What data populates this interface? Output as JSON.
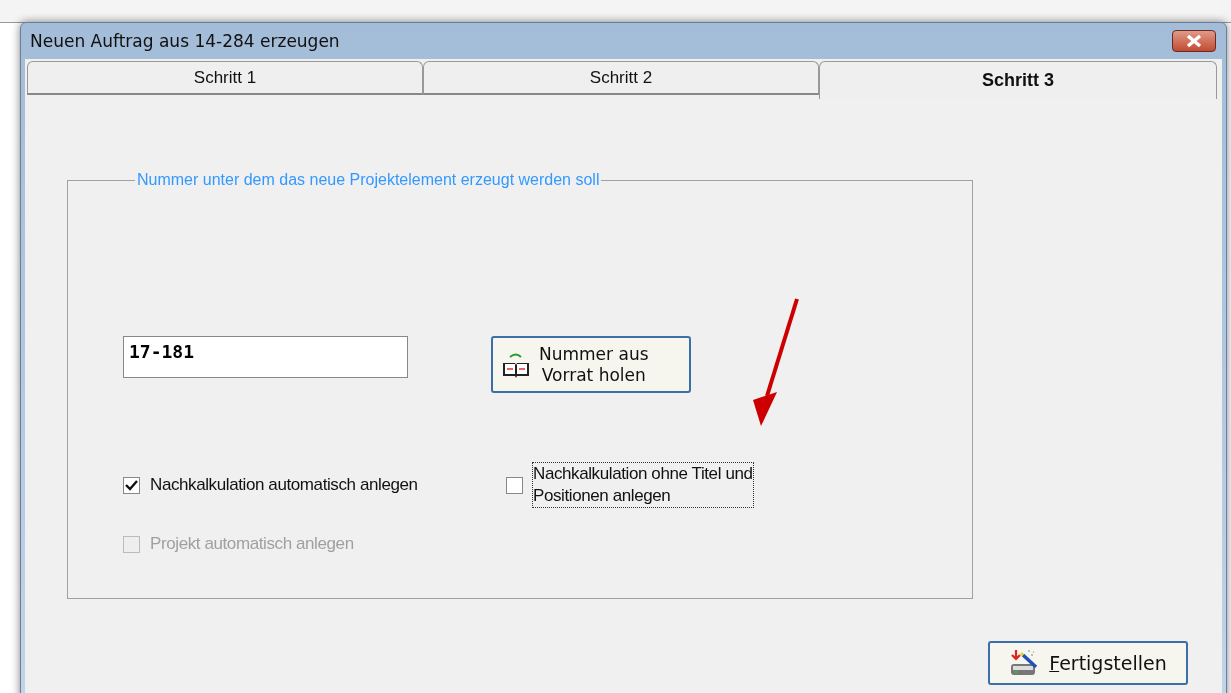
{
  "window": {
    "title": "Neuen Auftrag aus 14-284 erzeugen"
  },
  "tabs": [
    {
      "label": "Schritt 1",
      "selected": false
    },
    {
      "label": "Schritt 2",
      "selected": false
    },
    {
      "label": "Schritt 3",
      "selected": true
    }
  ],
  "group": {
    "legend": "Nummer unter dem das neue Projektelement erzeugt werden soll",
    "number_field": {
      "value": "17-181"
    },
    "fetch_button": {
      "label": "Nummer aus\nVorrat holen"
    },
    "options": [
      {
        "label": "Nachkalkulation automatisch anlegen",
        "checked": true,
        "disabled": false,
        "focused": false
      },
      {
        "label": "Nachkalkulation ohne Titel und\nPositionen anlegen",
        "checked": false,
        "disabled": false,
        "focused": true
      },
      {
        "label": "Projekt automatisch anlegen",
        "checked": false,
        "disabled": true,
        "focused": false
      }
    ]
  },
  "finish_button": {
    "label": "Fertigstellen",
    "mnemonic_underlined": true
  }
}
